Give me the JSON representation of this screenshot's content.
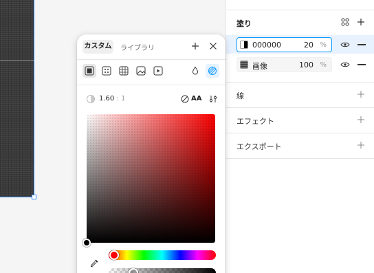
{
  "panel": {
    "fill_title": "塗り",
    "fills": [
      {
        "hex": "000000",
        "opacity": "20",
        "unit": "%"
      },
      {
        "label": "画像",
        "opacity": "100",
        "unit": "%"
      }
    ],
    "sections": [
      "線",
      "エフェクト",
      "エクスポート"
    ]
  },
  "picker": {
    "tabs": [
      "カスタム",
      "ライブラリ"
    ],
    "contrast_value": "1.60",
    "contrast_sep": ":",
    "contrast_base": "1",
    "aa_label": "AA"
  },
  "colors": {
    "accent": "#0d99ff",
    "selection": "#2f8cff",
    "fill_row_bg": "#e8f2ff"
  }
}
